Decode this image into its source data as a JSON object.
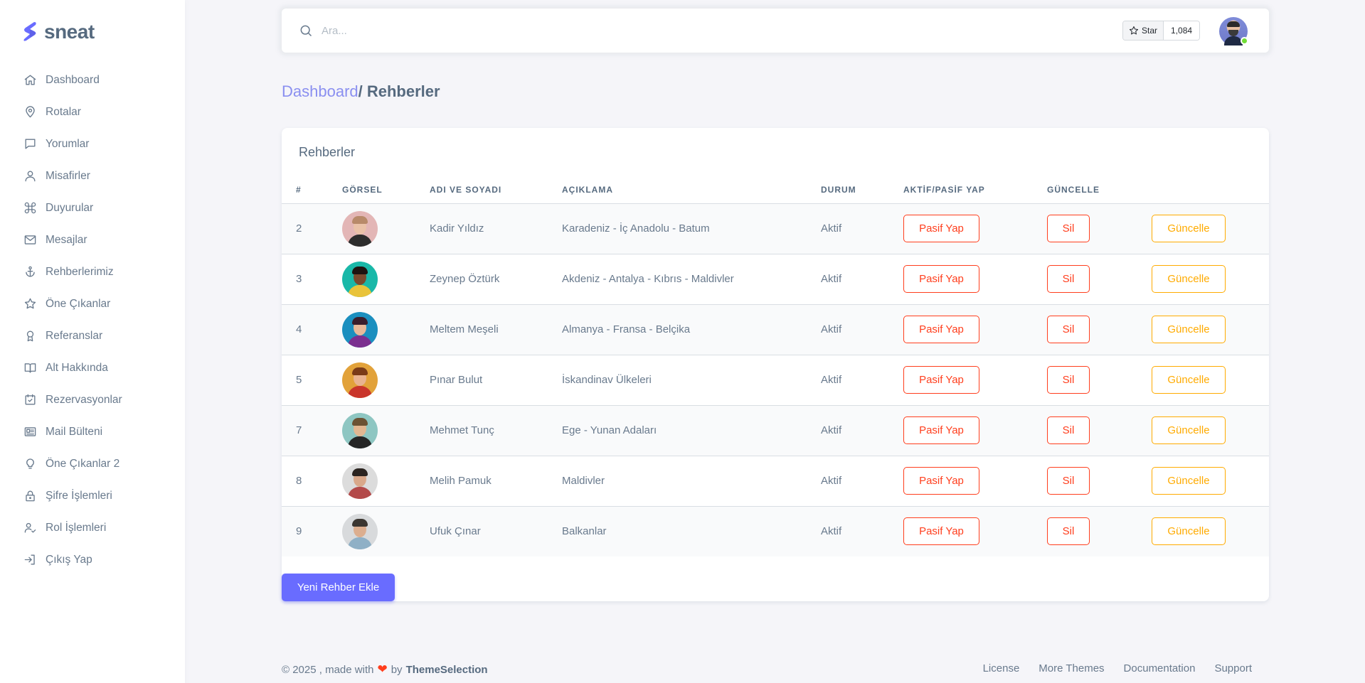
{
  "brand": {
    "name": "sneat"
  },
  "sidebar": {
    "items": [
      {
        "label": "Dashboard",
        "icon": "home-icon"
      },
      {
        "label": "Rotalar",
        "icon": "map-pin-icon"
      },
      {
        "label": "Yorumlar",
        "icon": "message-square-icon"
      },
      {
        "label": "Misafirler",
        "icon": "user-icon"
      },
      {
        "label": "Duyurular",
        "icon": "command-icon"
      },
      {
        "label": "Mesajlar",
        "icon": "envelope-icon"
      },
      {
        "label": "Rehberlerimiz",
        "icon": "anchor-icon"
      },
      {
        "label": "Öne Çıkanlar",
        "icon": "star-icon"
      },
      {
        "label": "Referanslar",
        "icon": "award-icon"
      },
      {
        "label": "Alt Hakkında",
        "icon": "book-open-icon"
      },
      {
        "label": "Rezervasyonlar",
        "icon": "calendar-check-icon"
      },
      {
        "label": "Mail Bülteni",
        "icon": "news-icon"
      },
      {
        "label": "Öne Çıkanlar 2",
        "icon": "bulb-icon"
      },
      {
        "label": "Şifre İşlemleri",
        "icon": "lock-icon"
      },
      {
        "label": "Rol İşlemleri",
        "icon": "user-check-icon"
      },
      {
        "label": "Çıkış Yap",
        "icon": "log-in-icon"
      }
    ]
  },
  "navbar": {
    "search_placeholder": "Ara...",
    "star_label": "Star",
    "star_count": "1,084"
  },
  "breadcrumb": {
    "link": "Dashboard",
    "current": "/ Rehberler"
  },
  "card": {
    "title": "Rehberler",
    "columns": [
      "#",
      "GÖRSEL",
      "ADI VE SOYADI",
      "AÇIKLAMA",
      "DURUM",
      "AKTİF/PASİF YAP",
      "GÜNCELLE",
      ""
    ],
    "rows": [
      {
        "id": "2",
        "name": "Kadir Yıldız",
        "desc": "Karadeniz - İç Anadolu - Batum",
        "status": "Aktif",
        "toggle": "Pasif Yap",
        "delete": "Sil",
        "update": "Güncelle"
      },
      {
        "id": "3",
        "name": "Zeynep Öztürk",
        "desc": "Akdeniz - Antalya - Kıbrıs - Maldivler",
        "status": "Aktif",
        "toggle": "Pasif Yap",
        "delete": "Sil",
        "update": "Güncelle"
      },
      {
        "id": "4",
        "name": "Meltem Meşeli",
        "desc": "Almanya - Fransa - Belçika",
        "status": "Aktif",
        "toggle": "Pasif Yap",
        "delete": "Sil",
        "update": "Güncelle"
      },
      {
        "id": "5",
        "name": "Pınar Bulut",
        "desc": "İskandinav Ülkeleri",
        "status": "Aktif",
        "toggle": "Pasif Yap",
        "delete": "Sil",
        "update": "Güncelle"
      },
      {
        "id": "7",
        "name": "Mehmet Tunç",
        "desc": "Ege - Yunan Adaları",
        "status": "Aktif",
        "toggle": "Pasif Yap",
        "delete": "Sil",
        "update": "Güncelle"
      },
      {
        "id": "8",
        "name": "Melih Pamuk",
        "desc": "Maldivler",
        "status": "Aktif",
        "toggle": "Pasif Yap",
        "delete": "Sil",
        "update": "Güncelle"
      },
      {
        "id": "9",
        "name": "Ufuk Çınar",
        "desc": "Balkanlar",
        "status": "Aktif",
        "toggle": "Pasif Yap",
        "delete": "Sil",
        "update": "Güncelle"
      }
    ],
    "add_button": "Yeni Rehber Ekle"
  },
  "footer": {
    "copyright": "© 2025 , made with",
    "by": "by",
    "brand": "ThemeSelection",
    "links": [
      "License",
      "More Themes",
      "Documentation",
      "Support"
    ]
  },
  "colors": {
    "primary": "#696cff",
    "danger": "#ff3e1d",
    "warning": "#ffab00",
    "text": "#566a7f",
    "background": "#f5f5f9",
    "online": "#71dd37"
  }
}
